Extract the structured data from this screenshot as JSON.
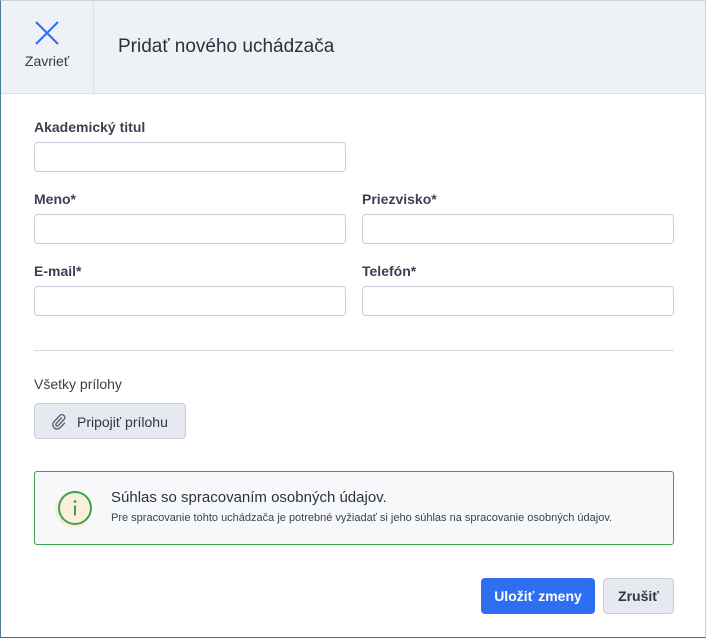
{
  "header": {
    "close_label": "Zavrieť",
    "title": "Pridať nového uchádzača"
  },
  "form": {
    "academic_title": {
      "label": "Akademický titul",
      "value": "",
      "placeholder": ""
    },
    "first_name": {
      "label": "Meno*",
      "value": "",
      "placeholder": ""
    },
    "last_name": {
      "label": "Priezvisko*",
      "value": "",
      "placeholder": ""
    },
    "email": {
      "label": "E-mail*",
      "value": "",
      "placeholder": ""
    },
    "phone": {
      "label": "Telefón*",
      "value": "",
      "placeholder": ""
    }
  },
  "attachments": {
    "section_label": "Všetky prílohy",
    "attach_button_label": "Pripojiť prílohu",
    "icon": "paperclip-icon"
  },
  "consent": {
    "icon": "info-icon",
    "title": "Súhlas so spracovaním osobných údajov.",
    "text": "Pre spracovanie tohto uchádzača je potrebné vyžiadať si jeho súhlas na spracovanie osobných údajov."
  },
  "footer": {
    "save_label": "Uložiť zmeny",
    "cancel_label": "Zrušiť"
  },
  "colors": {
    "accent": "#2d6ff0",
    "success": "#3fa34d",
    "header_bg": "#eef1f5"
  }
}
